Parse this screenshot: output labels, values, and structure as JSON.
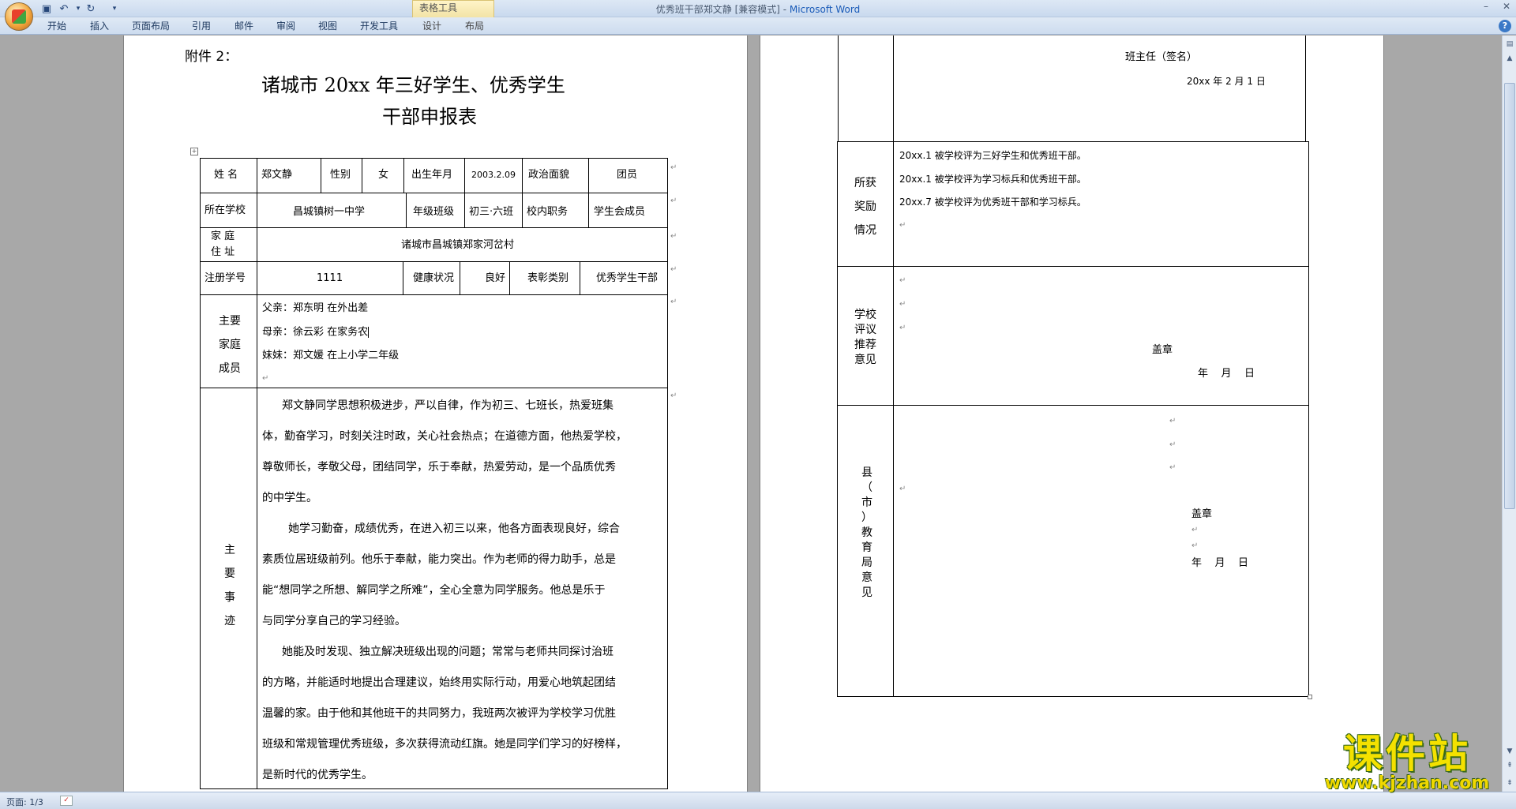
{
  "window": {
    "title": "优秀班干部郑文静 [兼容模式] - ",
    "app_name": "Microsoft Word",
    "context_tab_group": "表格工具",
    "minimize": "–",
    "close": "✕"
  },
  "ribbon": {
    "tabs": [
      "开始",
      "插入",
      "页面布局",
      "引用",
      "邮件",
      "审阅",
      "视图",
      "开发工具",
      "设计",
      "布局"
    ]
  },
  "form": {
    "attachment": "附件 2：",
    "title_line1": "诸城市 20xx 年三好学生、优秀学生",
    "title_line2": "干部申报表",
    "row1": {
      "name_label": "姓  名",
      "name": "郑文静",
      "gender_label": "性别",
      "gender": "女",
      "birth_label": "出生年月",
      "birth": "2003.2.09",
      "political_label": "政治面貌",
      "political": "团员"
    },
    "row2": {
      "school_label": "所在学校",
      "school": "昌城镇树一中学",
      "class_label": "年级班级",
      "class": "初三·六班",
      "duty_label": "校内职务",
      "duty": "学生会成员"
    },
    "row3": {
      "address_label_1": "家  庭",
      "address_label_2": "住  址",
      "address": "诸城市昌城镇郑家河岔村"
    },
    "row4": {
      "reg_label": "注册学号",
      "reg": "1111",
      "health_label": "健康状况",
      "health": "良好",
      "award_type_label": "表彰类别",
      "award_type": "优秀学生干部"
    },
    "family": {
      "label": [
        "主要",
        "家庭",
        "成员"
      ],
      "members": [
        "父亲：郑东明   在外出差",
        "母亲：徐云彩   在家务农",
        "妹妹：郑文媛   在上小学二年级"
      ]
    },
    "deeds": {
      "label": [
        "主",
        "要",
        "事",
        "迹"
      ],
      "lines": [
        "郑文静同学思想积极进步，严以自律，作为初三、七班长，热爱班集",
        "体，勤奋学习，时刻关注时政，关心社会热点；在道德方面，他热爱学校，",
        "尊敬师长，孝敬父母，团结同学，乐于奉献，热爱劳动，是一个品质优秀",
        "的中学生。",
        "她学习勤奋，成绩优秀，在进入初三以来，他各方面表现良好，综合",
        "素质位居班级前列。他乐于奉献，能力突出。作为老师的得力助手，总是",
        "能“想同学之所想、解同学之所难”，全心全意为同学服务。他总是乐于",
        "与同学分享自己的学习经验。",
        "她能及时发现、独立解决班级出现的问题；常常与老师共同探讨治班",
        "的方略，并能适时地提出合理建议，始终用实际行动，用爱心地筑起团结",
        "温馨的家。由于他和其他班干的共同努力，我班两次被评为学校学习优胜",
        "班级和常规管理优秀班级，多次获得流动红旗。她是同学们学习的好榜样，",
        "是新时代的优秀学生。"
      ]
    },
    "teacher_sign": "班主任（签名）",
    "teacher_date": "20xx 年 2 月 1 日",
    "awards": {
      "label": [
        "所获",
        "奖励",
        "情况"
      ],
      "items": [
        "20xx.1 被学校评为三好学生和优秀班干部。",
        "20xx.1 被学校评为学习标兵和优秀班干部。",
        "20xx.7 被学校评为优秀班干部和学习标兵。"
      ]
    },
    "school_opinion": {
      "label": [
        "学校",
        "评议",
        "推荐",
        "意见"
      ],
      "seal": "盖章",
      "date": "年    月    日"
    },
    "county_opinion": {
      "label": [
        "县",
        "（",
        "市",
        "）",
        "教",
        "育",
        "局",
        "意",
        "见"
      ],
      "seal": "盖章",
      "date": "年    月    日"
    }
  },
  "status": {
    "page": "页面: 1/3"
  },
  "watermark": {
    "text": "课件站",
    "url": "www.kjzhan.com"
  }
}
